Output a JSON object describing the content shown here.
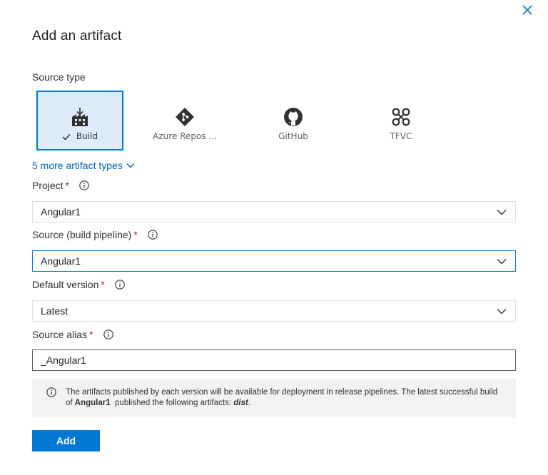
{
  "dialog": {
    "title": "Add an artifact",
    "close_icon": "close-icon"
  },
  "source_type": {
    "label": "Source type",
    "selected": "Build",
    "tiles": [
      {
        "label": "Build",
        "icon": "build-icon",
        "selected": true
      },
      {
        "label": "Azure Repos ...",
        "icon": "azure-repos-icon",
        "selected": false
      },
      {
        "label": "GitHub",
        "icon": "github-icon",
        "selected": false
      },
      {
        "label": "TFVC",
        "icon": "tfvc-icon",
        "selected": false
      }
    ],
    "more_link": "5 more artifact types"
  },
  "fields": {
    "project": {
      "label": "Project",
      "required_mark": "*",
      "value": "Angular1"
    },
    "source": {
      "label": "Source (build pipeline)",
      "required_mark": "*",
      "value": "Angular1"
    },
    "default_version": {
      "label": "Default version",
      "required_mark": "*",
      "value": "Latest"
    },
    "source_alias": {
      "label": "Source alias",
      "required_mark": "*",
      "value": "_Angular1"
    }
  },
  "info": {
    "text_1": "The artifacts published by each version will be available for deployment in release pipelines. The latest successful build of ",
    "bold_name": "Angular1",
    "text_2": "  published the following artifacts: ",
    "artifact": "dist",
    "text_3": "."
  },
  "actions": {
    "add_label": "Add"
  },
  "colors": {
    "accent": "#0078d4",
    "selected_tile_bg": "#deecf9",
    "required": "#a4262c",
    "link": "#0062ad"
  }
}
